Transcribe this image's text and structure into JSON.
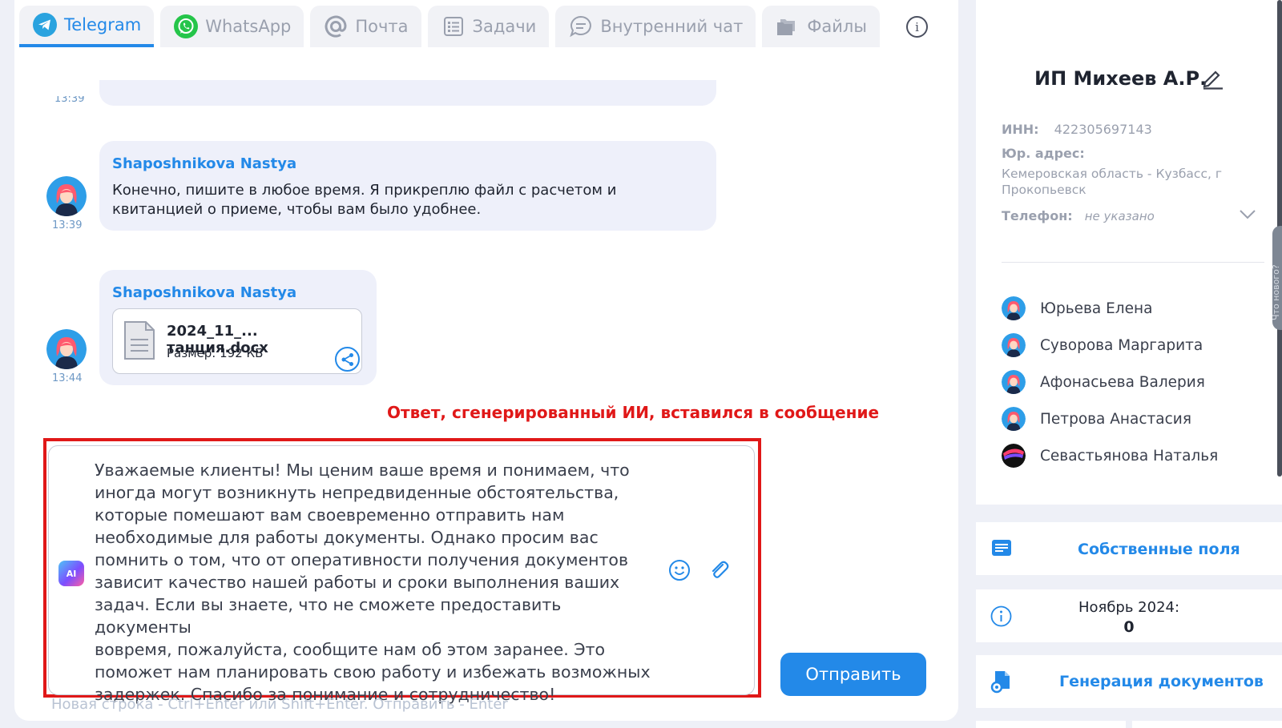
{
  "tabs": [
    {
      "label": "Telegram",
      "icon": "telegram-icon",
      "active": true
    },
    {
      "label": "WhatsApp",
      "icon": "whatsapp-icon"
    },
    {
      "label": "Почта",
      "icon": "at-icon"
    },
    {
      "label": "Задачи",
      "icon": "tasks-icon"
    },
    {
      "label": "Внутренний чат",
      "icon": "chat-bubble-icon"
    },
    {
      "label": "Файлы",
      "icon": "folder-icon"
    }
  ],
  "messages": [
    {
      "time": "13:39"
    },
    {
      "sender": "Shaposhnikova Nastya",
      "text": "Конечно, пишите в любое время. Я прикреплю файл с расчетом и квитанцией о приеме, чтобы вам было удобнее.",
      "time": "13:39"
    },
    {
      "sender": "Shaposhnikova Nastya",
      "file_name": "2024_11_... танция.docx",
      "file_size": "Размер: 192 КБ",
      "time": "13:44"
    }
  ],
  "annotation": "Ответ, сгенерированный ИИ, вставился в сообщение",
  "composer": {
    "text": "Уважаемые клиенты! Мы ценим ваше время и понимаем, что\nиногда могут возникнуть непредвиденные обстоятельства,\nкоторые помешают вам своевременно отправить нам\nнеобходимые для работы документы. Однако просим вас\nпомнить о том, что от оперативности получения документов\nзависит качество нашей работы и сроки выполнения ваших\nзадач. Если вы знаете, что не сможете предоставить документы\nвовремя, пожалуйста, сообщите нам об этом заранее. Это\nпоможет нам планировать свою работу и избежать возможных\nзадержек. Спасибо за понимание и сотрудничество!",
    "ai_label": "AI",
    "send_label": "Отправить",
    "hint": "Новая строка - Ctrl+Enter или Shift+Enter. Отправить - Enter"
  },
  "client": {
    "title": "ИП Михеев А.Р.",
    "inn_label": "ИНН:",
    "inn_value": "422305697143",
    "address_label": "Юр. адрес:",
    "address_value": "Кемеровская область - Кузбасс, г Прокопьевск",
    "phone_label": "Телефон:",
    "phone_value": "не указано"
  },
  "people": [
    "Юрьева Елена",
    "Суворова Маргарита",
    "Афонасьева Валерия",
    "Петрова Анастасия",
    "Севастьянова Наталья"
  ],
  "actions": {
    "own_fields": "Собственные поля",
    "month_label": "Ноябрь 2024:",
    "month_value": "0",
    "doc_gen": "Генерация документов"
  },
  "side_tab_label": "Что нового?",
  "colors": {
    "accent": "#2389e8",
    "annotation_red": "#e01818"
  }
}
